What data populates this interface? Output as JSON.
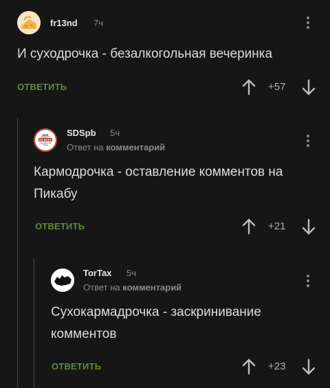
{
  "comments": [
    {
      "username": "fr13nd",
      "time": "7ч",
      "reply_prefix": "",
      "reply_target": "",
      "text": "И суходрочка - безалкогольная вечеринка",
      "reply_label": "ОТВЕТИТЬ",
      "score": "+57",
      "avatar_icon": "cheese-icon"
    },
    {
      "username": "SDSpb",
      "time": "5ч",
      "reply_prefix": "Ответ на",
      "reply_target": "комментарий",
      "text": "Кармодрочка - оставление комментов на Пикабу",
      "reply_label": "ОТВЕТИТЬ",
      "score": "+21",
      "avatar_icon": "badge-icon",
      "avatar_badge": {
        "line1": "МНЕ",
        "line2": "ПЛЕВАТЬ",
        "line3": "НА ВСЕХ",
        "line4": "И НА ДРУГИХ",
        "line5": "ТОЖЕ"
      }
    },
    {
      "username": "TorTax",
      "time": "5ч",
      "reply_prefix": "Ответ на",
      "reply_target": "комментарий",
      "text": "Сухокармадрочка - заскринивание комментов",
      "reply_label": "ОТВЕТИТЬ",
      "score": "+23",
      "avatar_icon": "cat-silhouette-icon"
    }
  ],
  "colors": {
    "background": "#161616",
    "accent": "#5f8c3c",
    "muted": "#8a8a8a",
    "text": "#dcdcdc"
  }
}
